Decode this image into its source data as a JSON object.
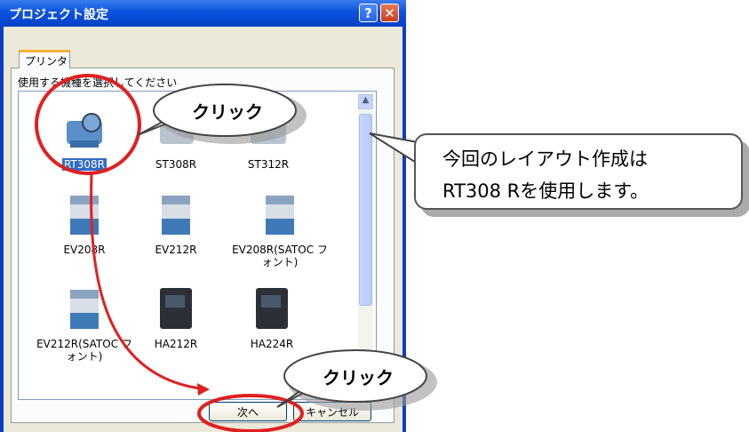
{
  "window": {
    "title": "プロジェクト設定",
    "help_glyph": "?",
    "close_glyph": "✕"
  },
  "tab": {
    "label": "プリンタ"
  },
  "instruction": "使用する機種を選択してください",
  "printers": [
    {
      "label": "RT308R",
      "icon": "printer-rt308r-icon",
      "selected": true
    },
    {
      "label": "ST308R",
      "icon": "printer-st308r-icon"
    },
    {
      "label": "ST312R",
      "icon": "printer-st312r-icon"
    },
    {
      "label": "EV208R",
      "icon": "printer-ev208r-icon"
    },
    {
      "label": "EV212R",
      "icon": "printer-ev212r-icon"
    },
    {
      "label": "EV208R(SATOC フォント)",
      "icon": "printer-ev208r-satoc-icon"
    },
    {
      "label": "EV212R(SATOC フォント)",
      "icon": "printer-ev212r-satoc-icon"
    },
    {
      "label": "HA212R",
      "icon": "printer-ha212r-icon"
    },
    {
      "label": "HA224R",
      "icon": "printer-ha224r-icon"
    }
  ],
  "buttons": {
    "next": "次へ",
    "cancel": "キャンセル"
  },
  "annotations": {
    "click_top": "クリック",
    "click_bottom": "クリック",
    "note_line1": "今回のレイアウト作成は",
    "note_line2": "RT308 Rを使用します。"
  },
  "colors": {
    "highlight": "#e02020",
    "selection": "#316ac5",
    "titlebar": "#0a52dc"
  }
}
